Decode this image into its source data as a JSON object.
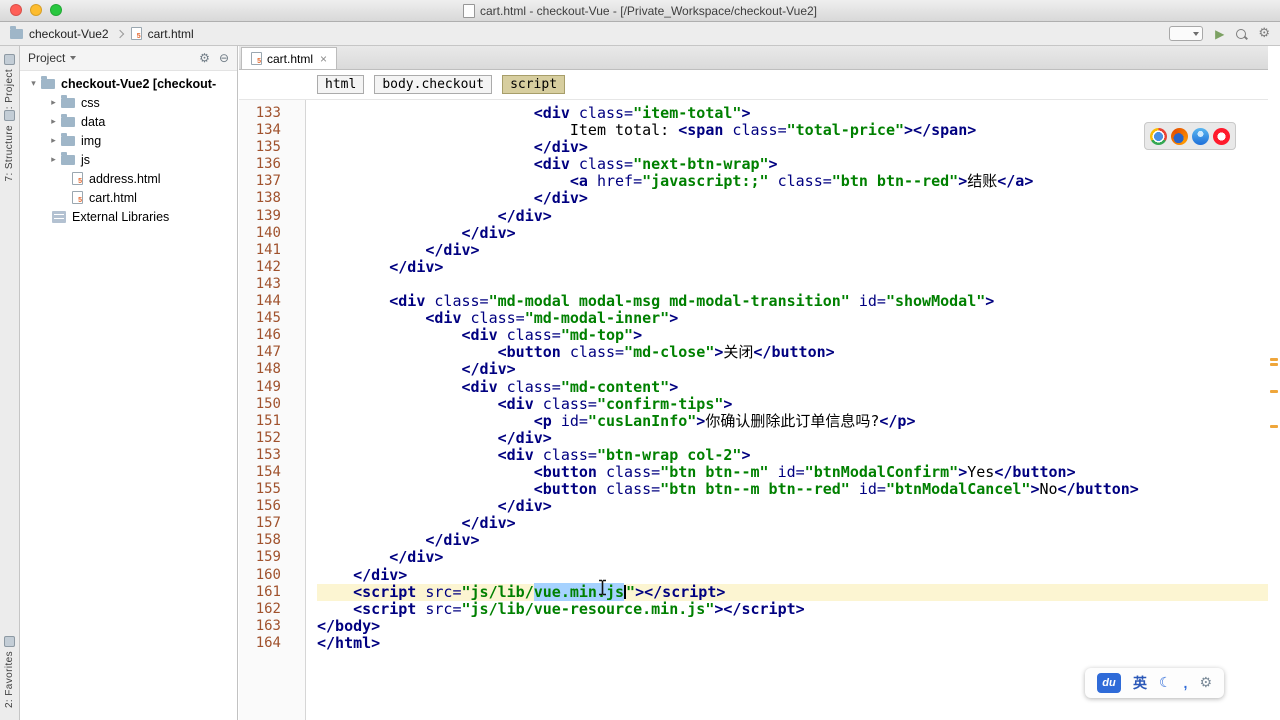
{
  "titlebar": {
    "title": "cart.html - checkout-Vue - [/Private_Workspace/checkout-Vue2]"
  },
  "toolbar": {
    "project": "checkout-Vue2",
    "file": "cart.html"
  },
  "tool_stripe": {
    "project": "1: Project",
    "structure": "7: Structure",
    "favorites": "2: Favorites"
  },
  "project_panel": {
    "title": "Project",
    "root": "checkout-Vue2 [checkout-",
    "folders": [
      "css",
      "data",
      "img",
      "js"
    ],
    "files": [
      "address.html",
      "cart.html"
    ],
    "external": "External Libraries"
  },
  "editor": {
    "tab_label": "cart.html",
    "tab_close": "×",
    "breadcrumbs": [
      "html",
      "body.checkout",
      "script"
    ],
    "stripe_marks": [
      312,
      317,
      344,
      379
    ],
    "lines": [
      {
        "n": 133,
        "ind": 24,
        "tok": [
          [
            "t",
            "<div "
          ],
          [
            "a",
            "class="
          ],
          [
            "v",
            "\"item-total\""
          ],
          [
            "t",
            ">"
          ]
        ]
      },
      {
        "n": 134,
        "ind": 28,
        "tok": [
          [
            "x",
            "Item total: "
          ],
          [
            "t",
            "<span "
          ],
          [
            "a",
            "class="
          ],
          [
            "v",
            "\"total-price\""
          ],
          [
            "t",
            "></span>"
          ]
        ]
      },
      {
        "n": 135,
        "ind": 24,
        "tok": [
          [
            "t",
            "</div>"
          ]
        ]
      },
      {
        "n": 136,
        "ind": 24,
        "tok": [
          [
            "t",
            "<div "
          ],
          [
            "a",
            "class="
          ],
          [
            "v",
            "\"next-btn-wrap\""
          ],
          [
            "t",
            ">"
          ]
        ]
      },
      {
        "n": 137,
        "ind": 28,
        "tok": [
          [
            "t",
            "<a "
          ],
          [
            "a",
            "href="
          ],
          [
            "v",
            "\"javascript:;\""
          ],
          [
            "a",
            " class="
          ],
          [
            "v",
            "\"btn btn--red\""
          ],
          [
            "t",
            ">"
          ],
          [
            "x",
            "结账"
          ],
          [
            "t",
            "</a>"
          ]
        ]
      },
      {
        "n": 138,
        "ind": 24,
        "tok": [
          [
            "t",
            "</div>"
          ]
        ]
      },
      {
        "n": 139,
        "ind": 20,
        "tok": [
          [
            "t",
            "</div>"
          ]
        ]
      },
      {
        "n": 140,
        "ind": 16,
        "tok": [
          [
            "t",
            "</div>"
          ]
        ]
      },
      {
        "n": 141,
        "ind": 12,
        "tok": [
          [
            "t",
            "</div>"
          ]
        ]
      },
      {
        "n": 142,
        "ind": 8,
        "tok": [
          [
            "t",
            "</div>"
          ]
        ]
      },
      {
        "n": 143,
        "ind": 0,
        "tok": []
      },
      {
        "n": 144,
        "ind": 8,
        "tok": [
          [
            "t",
            "<div "
          ],
          [
            "a",
            "class="
          ],
          [
            "v",
            "\"md-modal modal-msg md-modal-transition\""
          ],
          [
            "a",
            " id="
          ],
          [
            "v",
            "\"showModal\""
          ],
          [
            "t",
            ">"
          ]
        ]
      },
      {
        "n": 145,
        "ind": 12,
        "tok": [
          [
            "t",
            "<div "
          ],
          [
            "a",
            "class="
          ],
          [
            "v",
            "\"md-modal-inner\""
          ],
          [
            "t",
            ">"
          ]
        ]
      },
      {
        "n": 146,
        "ind": 16,
        "tok": [
          [
            "t",
            "<div "
          ],
          [
            "a",
            "class="
          ],
          [
            "v",
            "\"md-top\""
          ],
          [
            "t",
            ">"
          ]
        ]
      },
      {
        "n": 147,
        "ind": 20,
        "tok": [
          [
            "t",
            "<button "
          ],
          [
            "a",
            "class="
          ],
          [
            "v",
            "\"md-close\""
          ],
          [
            "t",
            ">"
          ],
          [
            "x",
            "关闭"
          ],
          [
            "t",
            "</button>"
          ]
        ]
      },
      {
        "n": 148,
        "ind": 16,
        "tok": [
          [
            "t",
            "</div>"
          ]
        ]
      },
      {
        "n": 149,
        "ind": 16,
        "tok": [
          [
            "t",
            "<div "
          ],
          [
            "a",
            "class="
          ],
          [
            "v",
            "\"md-content\""
          ],
          [
            "t",
            ">"
          ]
        ]
      },
      {
        "n": 150,
        "ind": 20,
        "tok": [
          [
            "t",
            "<div "
          ],
          [
            "a",
            "class="
          ],
          [
            "v",
            "\"confirm-tips\""
          ],
          [
            "t",
            ">"
          ]
        ]
      },
      {
        "n": 151,
        "ind": 24,
        "tok": [
          [
            "t",
            "<p "
          ],
          [
            "a",
            "id="
          ],
          [
            "v",
            "\"cusLanInfo\""
          ],
          [
            "t",
            ">"
          ],
          [
            "x",
            "你确认删除此订单信息吗?"
          ],
          [
            "t",
            "</p>"
          ]
        ]
      },
      {
        "n": 152,
        "ind": 20,
        "tok": [
          [
            "t",
            "</div>"
          ]
        ]
      },
      {
        "n": 153,
        "ind": 20,
        "tok": [
          [
            "t",
            "<div "
          ],
          [
            "a",
            "class="
          ],
          [
            "v",
            "\"btn-wrap col-2\""
          ],
          [
            "t",
            ">"
          ]
        ]
      },
      {
        "n": 154,
        "ind": 24,
        "tok": [
          [
            "t",
            "<button "
          ],
          [
            "a",
            "class="
          ],
          [
            "v",
            "\"btn btn--m\""
          ],
          [
            "a",
            " id="
          ],
          [
            "v",
            "\"btnModalConfirm\""
          ],
          [
            "t",
            ">"
          ],
          [
            "x",
            "Yes"
          ],
          [
            "t",
            "</button>"
          ]
        ]
      },
      {
        "n": 155,
        "ind": 24,
        "tok": [
          [
            "t",
            "<button "
          ],
          [
            "a",
            "class="
          ],
          [
            "v",
            "\"btn btn--m btn--red\""
          ],
          [
            "a",
            " id="
          ],
          [
            "v",
            "\"btnModalCancel\""
          ],
          [
            "t",
            ">"
          ],
          [
            "x",
            "No"
          ],
          [
            "t",
            "</button>"
          ]
        ]
      },
      {
        "n": 156,
        "ind": 20,
        "tok": [
          [
            "t",
            "</div>"
          ]
        ]
      },
      {
        "n": 157,
        "ind": 16,
        "tok": [
          [
            "t",
            "</div>"
          ]
        ]
      },
      {
        "n": 158,
        "ind": 12,
        "tok": [
          [
            "t",
            "</div>"
          ]
        ]
      },
      {
        "n": 159,
        "ind": 8,
        "tok": [
          [
            "t",
            "</div>"
          ]
        ]
      },
      {
        "n": 160,
        "ind": 4,
        "tok": [
          [
            "t",
            "</div>"
          ]
        ]
      },
      {
        "n": 161,
        "ind": 4,
        "caret": true,
        "tok": [
          [
            "t",
            "<script "
          ],
          [
            "a",
            "src="
          ],
          [
            "v",
            "\"js/lib/"
          ],
          [
            "sel",
            "vue.min.js"
          ],
          [
            "v",
            "\""
          ],
          [
            "t",
            "></script>"
          ]
        ]
      },
      {
        "n": 162,
        "ind": 4,
        "tok": [
          [
            "t",
            "<script "
          ],
          [
            "a",
            "src="
          ],
          [
            "v",
            "\"js/lib/vue-resource.min.js\""
          ],
          [
            "t",
            "></script>"
          ]
        ]
      },
      {
        "n": 163,
        "ind": 0,
        "tok": [
          [
            "t",
            "</body>"
          ]
        ]
      },
      {
        "n": 164,
        "ind": 0,
        "tok": [
          [
            "t",
            "</html>"
          ]
        ]
      }
    ]
  },
  "icons": {
    "chevron_open": "▾",
    "chevron_closed": "▸",
    "gear": "⚙",
    "collapse": "⊖",
    "play": "▶",
    "moon": "☾"
  },
  "ime": {
    "logo": "du",
    "lang": "英",
    "punct": ","
  },
  "browser_bar": [
    "chrome",
    "firefox",
    "safari",
    "opera"
  ],
  "colors": {
    "selection": "#A6D2FF",
    "caret_row": "#FCF5D2",
    "tag": "#000080",
    "attr_value": "#008000",
    "line_number": "#A0522D",
    "stripe_marker": "#EFA63B",
    "breadcrumb_active": "#D7CE9F",
    "ime_blue": "#2F6BD8"
  }
}
